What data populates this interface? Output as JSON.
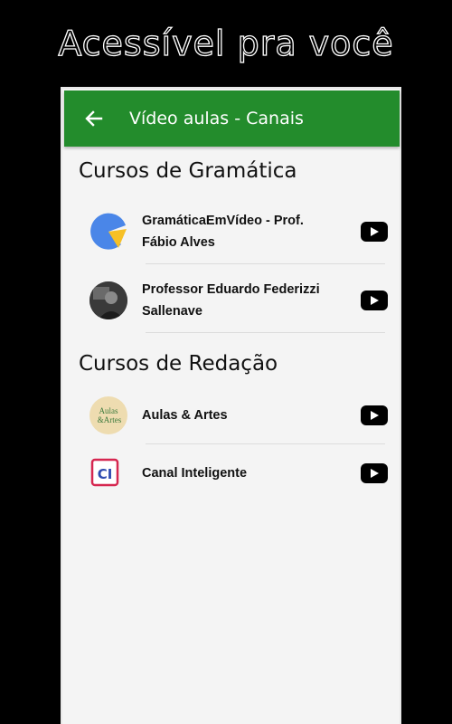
{
  "headline": "Acessível pra você",
  "appbar": {
    "title": "Vídeo aulas - Canais",
    "back_icon": "arrow-left-icon"
  },
  "colors": {
    "appbar": "#238c2c",
    "background": "#f4f4f4",
    "headline_outline": "#ffffff"
  },
  "sections": [
    {
      "title": "Cursos de Gramática",
      "channels": [
        {
          "name": "GramáticaEmVídeo - Prof. Fábio Alves",
          "action_icon": "youtube-play-icon"
        },
        {
          "name": "Professor Eduardo Federizzi Sallenave",
          "action_icon": "youtube-play-icon"
        }
      ]
    },
    {
      "title": "Cursos de Redação",
      "channels": [
        {
          "name": "Aulas & Artes",
          "logo_text": [
            "Aulas",
            "&Artes"
          ],
          "action_icon": "youtube-play-icon"
        },
        {
          "name": "Canal Inteligente",
          "logo_text": "CI",
          "action_icon": "youtube-play-icon"
        }
      ]
    }
  ]
}
